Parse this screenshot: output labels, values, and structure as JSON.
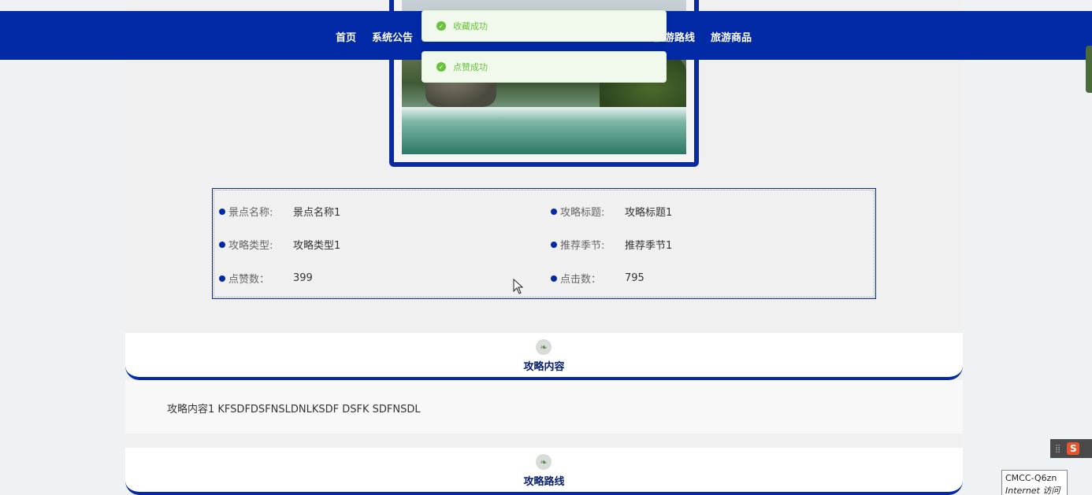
{
  "nav": {
    "items": [
      "首页",
      "系统公告",
      "旅游路线",
      "旅游商品"
    ]
  },
  "toasts": [
    {
      "icon": "check-circle-icon",
      "message": "收藏成功"
    },
    {
      "icon": "check-circle-icon",
      "message": "点赞成功"
    }
  ],
  "details": {
    "scenic_name": {
      "label": "景点名称:",
      "value": "景点名称1"
    },
    "guide_title": {
      "label": "攻略标题:",
      "value": "攻略标题1"
    },
    "guide_type": {
      "label": "攻略类型:",
      "value": "攻略类型1"
    },
    "season": {
      "label": "推荐季节:",
      "value": "推荐季节1"
    },
    "likes": {
      "label": "点赞数：",
      "value": "399"
    },
    "clicks": {
      "label": "点击数：",
      "value": "795"
    }
  },
  "sections": {
    "content": {
      "title": "攻略内容",
      "body": "攻略内容1 KFSDFDSFNSLDNLKSDF DSFK SDFNSDL"
    },
    "route": {
      "title": "攻略路线"
    }
  },
  "system": {
    "wifi_name": "CMCC-Q6zn",
    "wifi_status": "Internet 访问"
  },
  "colors": {
    "primary": "#0229a6",
    "success": "#67c23a"
  }
}
